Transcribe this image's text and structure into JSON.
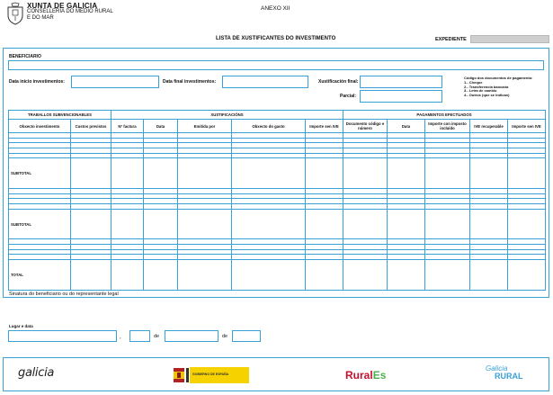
{
  "header": {
    "org_name": "XUNTA DE GALICIA",
    "department_line1": "CONSELLERÍA DO MEDIO RURAL",
    "department_line2": "E DO MAR",
    "annex": "ANEXO XII"
  },
  "form": {
    "title": "LISTA DE XUSTIFICANTES DO INVESTIMENTO",
    "expediente_label": "EXPEDIENTE",
    "beneficiario_label": "BENEFICIARIO",
    "data_inicio_label": "Data inicio investimentos:",
    "data_final_label": "Data final investimentos:",
    "xustificacion_final_label": "Xustificación final:",
    "parcial_label": "Parcial:",
    "legend": {
      "title_line1": "Código dos documentos de pagamento:",
      "items": [
        "1.- Cheque",
        "2.- Transferencia bancaria",
        "3.- Letra de cambio",
        "4.- Outros (que se indican)"
      ]
    }
  },
  "table": {
    "group_headers": {
      "traballos": "TRABALLOS SUBVENCIONABLES",
      "xustificacions": "XUSTIFICACIÓNS",
      "pagamentos": "PAGAMENTOS EFECTUADOS"
    },
    "columns": [
      "Obxecto investimento",
      "Custos previstos",
      "Nº factura",
      "Data",
      "Emitida por",
      "Obxecto do gasto",
      "Importe sen IVE",
      "Documento código e número",
      "Data",
      "Importe con imposto incluído",
      "IVE recuperable",
      "Importe sen IVE"
    ],
    "subtotal_label": "SUBTOTAL",
    "total_label": "TOTAL"
  },
  "signature": {
    "signature_label": "Sinatura do beneficiario ou do representante legal",
    "place_date_label": "Lugar e data",
    "comma": ",",
    "de1": "de",
    "de2": "de"
  },
  "footer": {
    "galicia_logo": "galicia",
    "rural_logo": "Rural",
    "rural_logo_suffix": "Es",
    "galicia_rural_line1": "Galicia",
    "galicia_rural_line2": "RURAL",
    "ministry_text": "GOBIERNO DE ESPAÑA"
  },
  "colors": {
    "accent": "#3aa0d8",
    "expediente_fill": "#cfcfcf"
  }
}
